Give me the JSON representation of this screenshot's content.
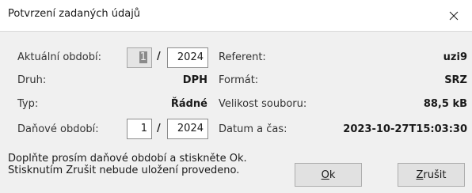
{
  "window": {
    "title": "Potvrzení zadaných údajů"
  },
  "left": {
    "aktualni_obdobi_label": "Aktuální období:",
    "aktualni_obdobi_month": "1",
    "aktualni_obdobi_year": "2024",
    "druh_label": "Druh:",
    "druh_value": "DPH",
    "typ_label": "Typ:",
    "typ_value": "Řádné",
    "danove_obdobi_label": "Daňové období:",
    "danove_obdobi_month": "1",
    "danove_obdobi_year": "2024",
    "separator": "/"
  },
  "right": {
    "referent_label": "Referent:",
    "referent_value": "uzi9",
    "format_label": "Formát:",
    "format_value": "SRZ",
    "velikost_label": "Velikost souboru:",
    "velikost_value": "88,5 kB",
    "datum_label": "Datum a čas:",
    "datum_value": "2023-10-27T15:03:30"
  },
  "message": "Doplňte prosím daňové období a stiskněte Ok. Stisknutím Zrušit nebude uložení provedeno.",
  "buttons": {
    "ok_mnemonic": "O",
    "ok_rest": "k",
    "cancel_mnemonic": "Z",
    "cancel_rest": "rušit"
  }
}
